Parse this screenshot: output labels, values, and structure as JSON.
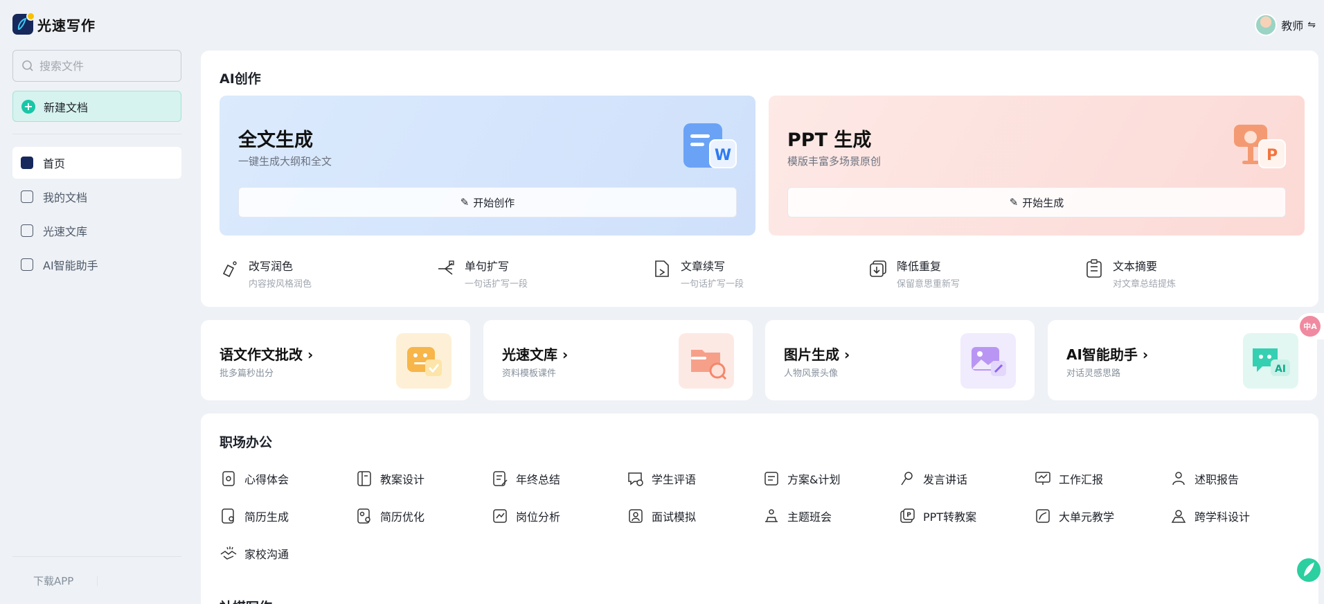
{
  "app": {
    "name": "光速写作"
  },
  "user": {
    "name": "教师",
    "switch_glyph": "⇋"
  },
  "sidebar": {
    "search_placeholder": "搜索文件",
    "new_doc": "新建文档",
    "items": [
      {
        "label": "首页",
        "icon": "home-icon",
        "active": true
      },
      {
        "label": "我的文档",
        "icon": "document-icon",
        "active": false
      },
      {
        "label": "光速文库",
        "icon": "library-icon",
        "active": false
      },
      {
        "label": "AI智能助手",
        "icon": "assistant-icon",
        "active": false
      }
    ],
    "download": "下载APP"
  },
  "ai": {
    "title": "AI创作",
    "full_text": {
      "title": "全文生成",
      "subtitle": "一键生成大纲和全文",
      "button": "开始创作"
    },
    "ppt": {
      "title": "PPT 生成",
      "subtitle": "模版丰富多场景原创",
      "button": "开始生成"
    },
    "tools": [
      {
        "name": "改写润色",
        "desc": "内容按风格润色",
        "icon": "rewrite-icon"
      },
      {
        "name": "单句扩写",
        "desc": "一句话扩写一段",
        "icon": "expand-icon"
      },
      {
        "name": "文章续写",
        "desc": "一句话扩写一段",
        "icon": "continue-icon"
      },
      {
        "name": "降低重复",
        "desc": "保留意思重新写",
        "icon": "dedupe-icon"
      },
      {
        "name": "文本摘要",
        "desc": "对文章总结提炼",
        "icon": "summary-icon"
      }
    ]
  },
  "minis": [
    {
      "title": "语文作文批改",
      "subtitle": "批多篇秒出分",
      "icon": "essay-correct-icon",
      "color": "#fdecc8"
    },
    {
      "title": "光速文库",
      "subtitle": "资料模板课件",
      "icon": "folder-search-icon",
      "color": "#fde4de"
    },
    {
      "title": "图片生成",
      "subtitle": "人物风景头像",
      "icon": "image-gen-icon",
      "color": "#ebe3fb"
    },
    {
      "title": "AI智能助手",
      "subtitle": "对话灵感思路",
      "icon": "ai-chat-icon",
      "color": "#d9f5ef"
    }
  ],
  "office": {
    "title": "职场办公",
    "items": [
      "心得体会",
      "教案设计",
      "年终总结",
      "学生评语",
      "方案&计划",
      "发言讲话",
      "工作汇报",
      "述职报告",
      "简历生成",
      "简历优化",
      "岗位分析",
      "面试模拟",
      "主题班会",
      "PPT转教案",
      "大单元教学",
      "跨学科设计",
      "家校沟通"
    ]
  },
  "next_section_title": "社媒写作",
  "translate_badge": "中A"
}
